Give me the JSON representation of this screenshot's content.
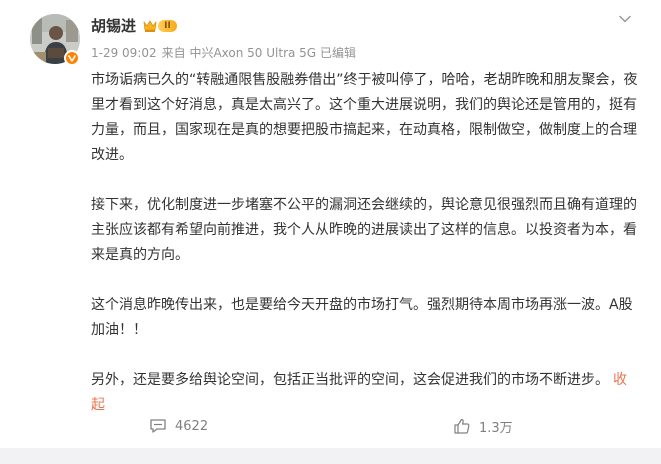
{
  "post": {
    "author": {
      "name": "胡锡进",
      "level_badge": "II"
    },
    "meta": {
      "time": "1-29 09:02",
      "source": "来自 中兴Axon 50 Ultra 5G",
      "edited": "已编辑"
    },
    "paragraphs": [
      "市场诟病已久的“转融通限售股融券借出”终于被叫停了，哈哈，老胡昨晚和朋友聚会，夜里才看到这个好消息，真是太高兴了。这个重大进展说明，我们的舆论还是管用的，挺有力量，而且，国家现在是真的想要把股市搞起来，在动真格，限制做空，做制度上的合理改进。",
      "接下来，优化制度进一步堵塞不公平的漏洞还会继续的，舆论意见很强烈而且确有道理的主张应该都有希望向前推进，我个人从昨晚的进展读出了这样的信息。以投资者为本，看来是真的方向。",
      "这个消息昨晚传出来，也是要给今天开盘的市场打气。强烈期待本周市场再涨一波。A股加油！！"
    ],
    "last_paragraph": "另外，还是要多给舆论空间，包括正当批评的空间，这会促进我们的市场不断进步。",
    "collapse_label": "收起",
    "actions": {
      "comments": "4622",
      "likes": "1.3万"
    }
  },
  "icons": {
    "more": "chevron-down-icon",
    "comment": "comment-icon",
    "like": "thumbs-up-icon",
    "crown": "crown-icon",
    "verify": "verified-badge-icon"
  },
  "colors": {
    "link": "#eb7350",
    "verify": "#ff8200",
    "meta_text": "#939393",
    "body_text": "#333333",
    "level_badge": "#f8a91a"
  }
}
